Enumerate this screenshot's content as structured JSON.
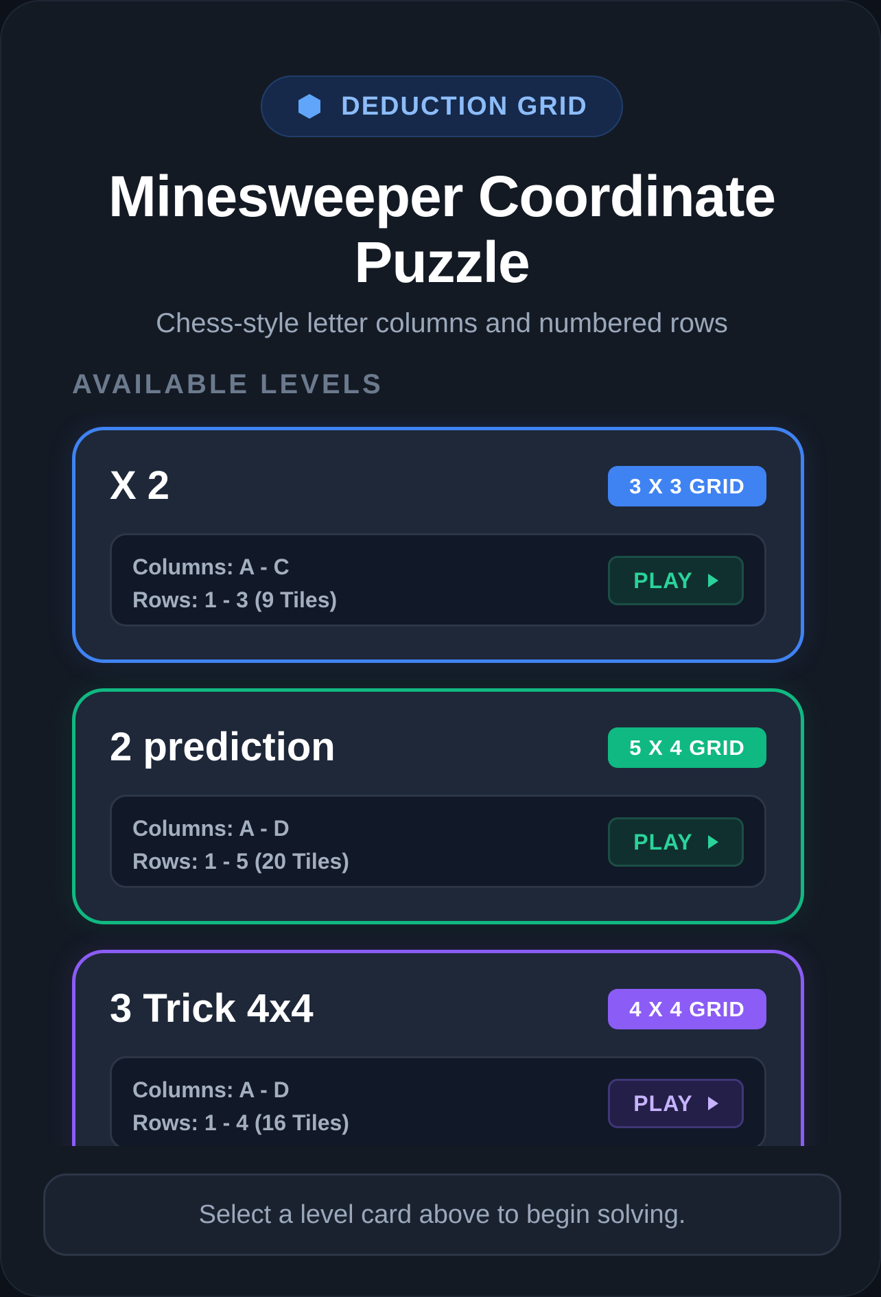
{
  "header": {
    "chip_label": "DEDUCTION GRID",
    "chip_icon": "hexagon-icon",
    "title_line1": "Minesweeper Coordinate",
    "title_line2": "Puzzle",
    "subtitle": "Chess-style letter columns and numbered rows"
  },
  "section_label": "AVAILABLE LEVELS",
  "levels": [
    {
      "title": "X 2",
      "badge": "3 X 3 GRID",
      "columns": "Columns: A - C",
      "rows": "Rows: 1 - 3 (9 Tiles)",
      "play_label": "PLAY",
      "accent": "#3f83f3"
    },
    {
      "title": "2 prediction",
      "badge": "5 X 4 GRID",
      "columns": "Columns: A - D",
      "rows": "Rows: 1 - 5 (20 Tiles)",
      "play_label": "PLAY",
      "accent": "#10b981"
    },
    {
      "title": "3 Trick 4x4",
      "badge": "4 X 4 GRID",
      "columns": "Columns: A - D",
      "rows": "Rows: 1 - 4 (16 Tiles)",
      "play_label": "PLAY",
      "accent": "#8b5cf6"
    }
  ],
  "footer_text": "Select a level card above to begin solving.",
  "colors": {
    "background": "#141a24",
    "card": "#1e2839",
    "text_primary": "#ffffff",
    "text_secondary": "#9ba8bb"
  }
}
